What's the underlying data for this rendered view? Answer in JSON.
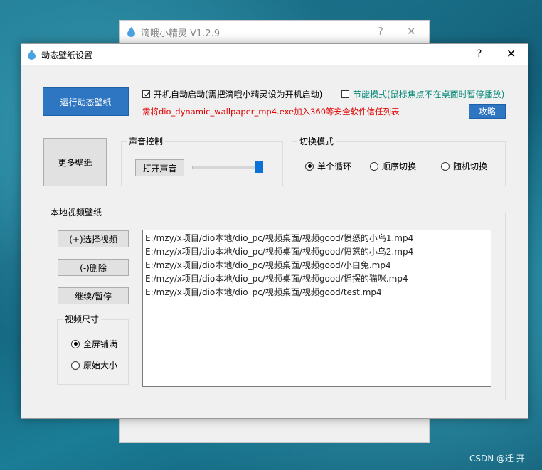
{
  "background_window": {
    "title": "滴哦小精灵 V1.2.9",
    "help": "?",
    "close": "✕"
  },
  "dialog": {
    "title": "动态壁纸设置",
    "help": "?",
    "close": "✕",
    "run_button": "运行动态壁纸",
    "autostart": {
      "label": "开机自动启动(需把滴哦小精灵设为开机启动)",
      "checked": true
    },
    "powersave": {
      "label": "节能模式(鼠标焦点不在桌面时暂停播放)",
      "checked": false
    },
    "warning": "需将dio_dynamic_wallpaper_mp4.exe加入360等安全软件信任列表",
    "guide_button": "攻略",
    "more_button": "更多壁纸",
    "sound": {
      "group_label": "声音控制",
      "toggle_button": "打开声音",
      "volume": 1.0
    },
    "switch_mode": {
      "group_label": "切换模式",
      "options": [
        "单个循环",
        "顺序切换",
        "随机切换"
      ],
      "selected": "单个循环"
    },
    "local_video": {
      "group_label": "本地视频壁纸",
      "select_button": "(+)选择视频",
      "delete_button": "(-)删除",
      "pause_button": "继续/暂停",
      "size_group_label": "视频尺寸",
      "size_options": [
        "全屏铺满",
        "原始大小"
      ],
      "size_selected": "全屏铺满",
      "files": [
        "E:/mzy/x项目/dio本地/dio_pc/视频桌面/视频good/愤怒的小鸟1.mp4",
        "E:/mzy/x项目/dio本地/dio_pc/视频桌面/视频good/愤怒的小鸟2.mp4",
        "E:/mzy/x项目/dio本地/dio_pc/视频桌面/视频good/小白兔.mp4",
        "E:/mzy/x项目/dio本地/dio_pc/视频桌面/视频good/摇摆的猫咪.mp4",
        "E:/mzy/x项目/dio本地/dio_pc/视频桌面/视频good/test.mp4"
      ]
    }
  },
  "watermark": "CSDN @迁  开",
  "colors": {
    "warning": "#e00000",
    "powersave": "#0a8a7a",
    "accent": "#2e75c2"
  }
}
